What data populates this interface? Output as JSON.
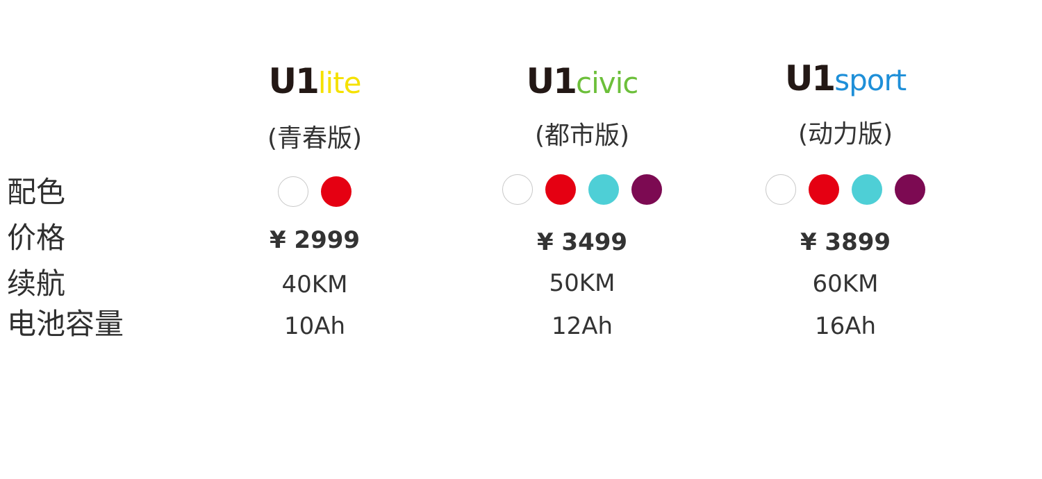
{
  "row_labels": {
    "colors": "配色",
    "price": "价格",
    "range": "续航",
    "battery": "电池容量"
  },
  "models": [
    {
      "logo_prefix": "U1",
      "logo_variant": "lite",
      "variant_color": "#f5e100",
      "edition": "(青春版)",
      "swatches": [
        "#ffffff",
        "#e50012"
      ],
      "price": "¥ 2999",
      "range": "40KM",
      "battery": "10Ah"
    },
    {
      "logo_prefix": "U1",
      "logo_variant": "civic",
      "variant_color": "#6cbf3a",
      "edition": "(都市版)",
      "swatches": [
        "#ffffff",
        "#e50012",
        "#4ecfd6",
        "#7c0a52"
      ],
      "price": "¥ 3499",
      "range": "50KM",
      "battery": "12Ah"
    },
    {
      "logo_prefix": "U1",
      "logo_variant": "sport",
      "variant_color": "#1e8fd8",
      "edition": "(动力版)",
      "swatches": [
        "#ffffff",
        "#e50012",
        "#4ecfd6",
        "#7c0a52"
      ],
      "price": "¥ 3899",
      "range": "60KM",
      "battery": "16Ah"
    }
  ]
}
